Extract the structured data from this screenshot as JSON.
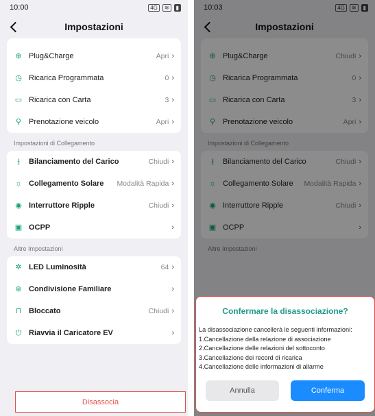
{
  "left": {
    "status_time": "10:00",
    "title": "Impostazioni",
    "rows_top": [
      {
        "label": "Plug&Charge",
        "value": "Apri"
      },
      {
        "label": "Ricarica Programmata",
        "value": "0"
      },
      {
        "label": "Ricarica con Carta",
        "value": "3"
      },
      {
        "label": "Prenotazione veicolo",
        "value": "Apri"
      }
    ],
    "section_collegamento": "Impostazioni di Collegamento",
    "rows_collegamento": [
      {
        "label": "Bilanciamento del Carico",
        "value": "Chiudi"
      },
      {
        "label": "Collegamento Solare",
        "value": "Modalità Rapida"
      },
      {
        "label": "Interruttore Ripple",
        "value": "Chiudi"
      },
      {
        "label": "OCPP",
        "value": ""
      }
    ],
    "section_altre": "Altre Impostazioni",
    "rows_altre": [
      {
        "label": "LED Luminosità",
        "value": "64"
      },
      {
        "label": "Condivisione Familiare",
        "value": ""
      },
      {
        "label": "Bloccato",
        "value": "Chiudi"
      },
      {
        "label": "Riavvia il Caricatore EV",
        "value": ""
      }
    ],
    "disassocia": "Disassocia"
  },
  "right": {
    "status_time": "10:03",
    "title": "Impostazioni",
    "rows_top": [
      {
        "label": "Plug&Charge",
        "value": "Chiudi"
      },
      {
        "label": "Ricarica Programmata",
        "value": "0"
      },
      {
        "label": "Ricarica con Carta",
        "value": "3"
      },
      {
        "label": "Prenotazione veicolo",
        "value": "Apri"
      }
    ],
    "section_collegamento": "Impostazioni di Collegamento",
    "rows_collegamento": [
      {
        "label": "Bilanciamento del Carico",
        "value": "Chiudi"
      },
      {
        "label": "Collegamento Solare",
        "value": "Modalità Rapida"
      },
      {
        "label": "Interruttore Ripple",
        "value": "Chiudi"
      },
      {
        "label": "OCPP",
        "value": ""
      }
    ],
    "section_altre": "Altre Impostazioni",
    "dialog": {
      "title": "Confermare la disassociazione?",
      "lines": [
        "La disassociazione cancellerà le seguenti informazioni:",
        "1.Cancellazione della relazione di associazione",
        "2.Cancellazione delle relazioni del sottoconto",
        "3.Cancellazione dei record di ricarica",
        "4.Cancellazione delle informazioni di allarme"
      ],
      "cancel": "Annulla",
      "confirm": "Conferma"
    }
  },
  "colors": {
    "accent": "#1aa27a",
    "danger": "#e0524a",
    "primary_button": "#1a8cff",
    "dialog_title": "#1f9a8a"
  },
  "icons": {
    "plug_charge": "plug-charge-icon",
    "programmata": "timer-icon",
    "carta": "card-icon",
    "prenotazione": "vehicle-icon",
    "bilanciamento": "balance-icon",
    "solare": "solar-icon",
    "ripple": "ripple-icon",
    "ocpp": "ocpp-icon",
    "led": "brightness-icon",
    "condivisione": "family-icon",
    "bloccato": "lock-icon",
    "riavvia": "power-icon"
  }
}
